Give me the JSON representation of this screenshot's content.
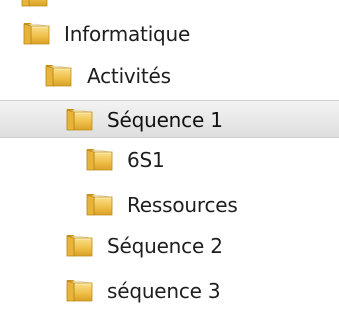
{
  "tree": {
    "items": [
      {
        "label": "",
        "icon": "folder-icon"
      },
      {
        "label": "Informatique",
        "icon": "folder-icon"
      },
      {
        "label": "Activités",
        "icon": "folder-icon"
      },
      {
        "label": "Séquence 1",
        "icon": "folder-icon",
        "selected": true
      },
      {
        "label": "6S1",
        "icon": "folder-icon"
      },
      {
        "label": "Ressources",
        "icon": "folder-icon"
      },
      {
        "label": "Séquence 2",
        "icon": "folder-icon"
      },
      {
        "label": "séquence 3",
        "icon": "folder-icon"
      }
    ]
  },
  "colors": {
    "selection_background": "#e6e6e6",
    "folder_yellow": "#f0c24a",
    "text": "#1e1e1e"
  }
}
